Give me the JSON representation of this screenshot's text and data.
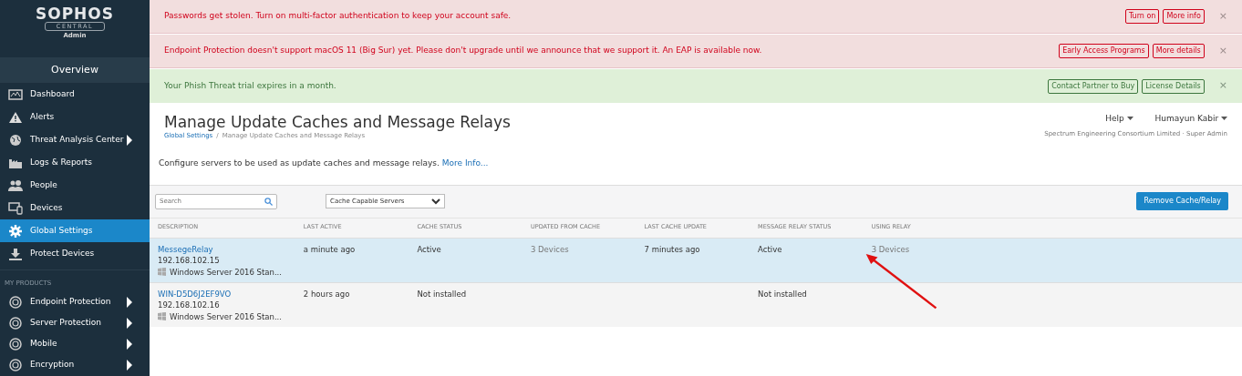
{
  "sidebar": {
    "logo": {
      "brand": "SOPHOS",
      "product": "CENTRAL",
      "role": "Admin"
    },
    "heading": "Overview",
    "items": [
      {
        "label": "Dashboard",
        "selected": false,
        "submenu": false
      },
      {
        "label": "Alerts",
        "selected": false,
        "submenu": false
      },
      {
        "label": "Threat Analysis Center",
        "selected": false,
        "submenu": true
      },
      {
        "label": "Logs & Reports",
        "selected": false,
        "submenu": false
      },
      {
        "label": "People",
        "selected": false,
        "submenu": false
      },
      {
        "label": "Devices",
        "selected": false,
        "submenu": false
      },
      {
        "label": "Global Settings",
        "selected": true,
        "submenu": false
      },
      {
        "label": "Protect Devices",
        "selected": false,
        "submenu": false
      }
    ],
    "section_title": "MY PRODUCTS",
    "products": [
      {
        "label": "Endpoint Protection",
        "selected": false,
        "submenu": true
      },
      {
        "label": "Server Protection",
        "selected": false,
        "submenu": true
      },
      {
        "label": "Mobile",
        "selected": false,
        "submenu": true
      },
      {
        "label": "Encryption",
        "selected": false,
        "submenu": true
      }
    ]
  },
  "alerts": [
    {
      "kind": "danger",
      "message": "Passwords get stolen. Turn on multi-factor authentication to keep your account safe.",
      "buttons": [
        "Turn on",
        "More info"
      ],
      "close": "×"
    },
    {
      "kind": "danger",
      "message": "Endpoint Protection doesn't support macOS 11 (Big Sur) yet. Please don't upgrade until we announce that we support it. An EAP is available now.",
      "buttons": [
        "Early Access Programs",
        "More details"
      ],
      "close": "×"
    },
    {
      "kind": "success",
      "message": "Your Phish Threat trial expires in a month.",
      "buttons": [
        "Contact Partner to Buy",
        "License Details"
      ],
      "close": "×"
    }
  ],
  "page": {
    "title": "Manage Update Caches and Message Relays",
    "breadcrumb": [
      "Global Settings",
      "Manage Update Caches and Message Relays"
    ],
    "separator": "/",
    "help": "Help",
    "user": "Humayun Kabir",
    "account": "Spectrum Engineering Consortium Limited · Super Admin",
    "description": "Configure servers to be used as update caches and message relays.",
    "more_link": "More Info..."
  },
  "toolbar": {
    "search": {
      "placeholder": "Search"
    },
    "filter": "Cache Capable Servers",
    "action": "Remove Cache/Relay"
  },
  "table": {
    "columns": [
      "DESCRIPTION",
      "LAST ACTIVE",
      "CACHE STATUS",
      "UPDATED FROM CACHE",
      "LAST CACHE UPDATE",
      "MESSAGE RELAY STATUS",
      "USING RELAY"
    ],
    "rows": [
      {
        "selected": true,
        "description": {
          "name": "MessegeRelay",
          "ip": "192.168.102.15",
          "os": "Windows Server 2016 Stan..."
        },
        "last_active": "a minute ago",
        "cache_status": "Active",
        "updated_from_cache": "3 Devices",
        "last_cache_update": "7 minutes ago",
        "message_relay_status": "Active",
        "using_relay": "3 Devices"
      },
      {
        "selected": false,
        "description": {
          "name": "WIN-D5D6J2EF9VO",
          "ip": "192.168.102.16",
          "os": "Windows Server 2016 Stan..."
        },
        "last_active": "2 hours ago",
        "cache_status": "Not installed",
        "message_relay_status": "Not installed"
      }
    ]
  }
}
